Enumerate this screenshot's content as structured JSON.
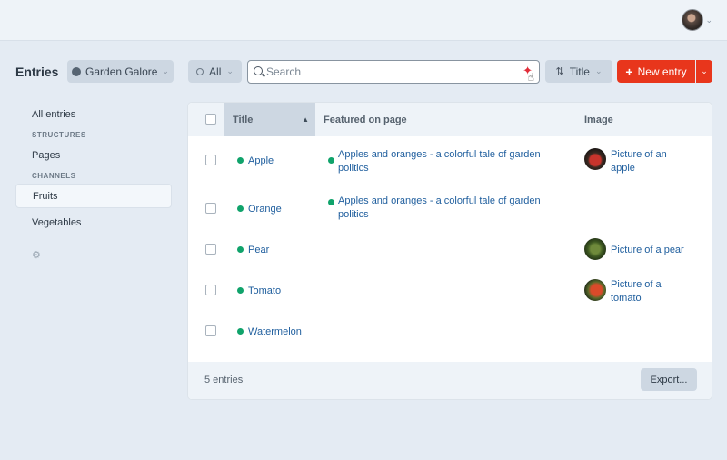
{
  "header": {
    "page_title": "Entries",
    "site_label": "Garden Galore",
    "status_label": "All",
    "search_placeholder": "Search",
    "sort_label": "Title",
    "new_entry_label": "New entry"
  },
  "sidebar": {
    "items": [
      {
        "label": "All entries"
      },
      {
        "heading": "STRUCTURES"
      },
      {
        "label": "Pages"
      },
      {
        "heading": "CHANNELS"
      },
      {
        "label": "Fruits",
        "active": true
      },
      {
        "label": "Vegetables"
      }
    ]
  },
  "table": {
    "columns": [
      "Title",
      "Featured on page",
      "Image"
    ],
    "rows": [
      {
        "title": "Apple",
        "featured": "Apples and oranges - a colorful tale of garden politics",
        "image": "Picture of an apple"
      },
      {
        "title": "Orange",
        "featured": "Apples and oranges - a colorful tale of garden politics",
        "image": ""
      },
      {
        "title": "Pear",
        "featured": "",
        "image": "Picture of a pear"
      },
      {
        "title": "Tomato",
        "featured": "",
        "image": "Picture of a tomato"
      },
      {
        "title": "Watermelon",
        "featured": "",
        "image": ""
      }
    ],
    "footer_count": "5 entries",
    "export_label": "Export..."
  },
  "colors": {
    "accent": "#e8361c",
    "status_dot": "#10a36b",
    "link": "#205f9e"
  }
}
